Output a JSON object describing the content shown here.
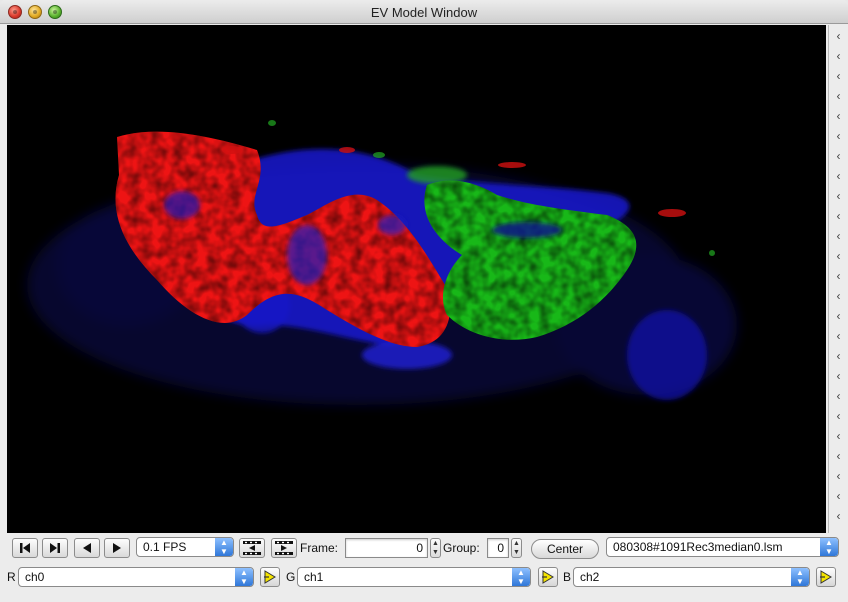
{
  "window": {
    "title": "EV Model Window"
  },
  "playback": {
    "fps_value": "0.1 FPS",
    "frame_label": "Frame:",
    "frame_value": "0",
    "group_label": "Group:",
    "group_value": "0",
    "center_label": "Center",
    "file_value": "080308#1091Rec3median0.lsm"
  },
  "channels": [
    {
      "letter": "R",
      "value": "ch0"
    },
    {
      "letter": "G",
      "value": "ch1"
    },
    {
      "letter": "B",
      "value": "ch2"
    }
  ],
  "colors": {
    "red_channel": "#ff1a1a",
    "green_channel": "#22cc22",
    "blue_channel": "#1a1ad8",
    "viewport_background": "#000000",
    "combo_arrow": "#2f77d8"
  },
  "icons": {
    "first": "skip-to-start-icon",
    "step_forward": "step-forward-icon",
    "play_back": "play-backward-icon",
    "play_forward": "play-forward-icon",
    "movie_back": "film-back-icon",
    "movie_forward": "film-forward-icon",
    "side_strip": "chevron-left-icon",
    "channel_apply": "yellow-play-icon"
  }
}
